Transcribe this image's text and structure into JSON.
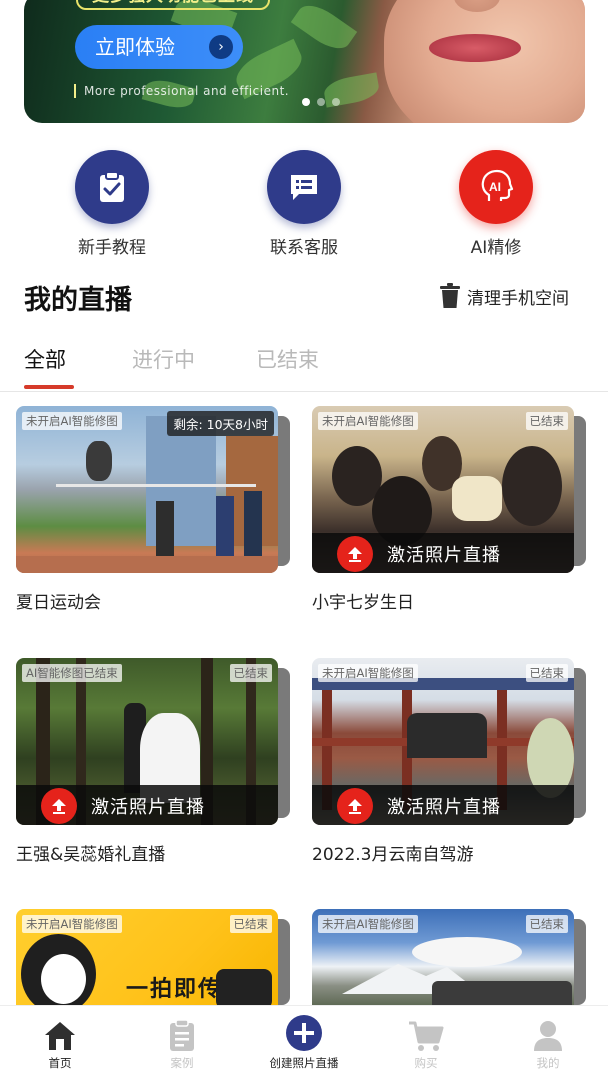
{
  "banner": {
    "headline": "更多强大功能已上线",
    "cta_label": "立即体验",
    "subtitle": "More professional and efficient.",
    "carousel_pages": 3,
    "carousel_active": 1
  },
  "quick_actions": [
    {
      "label": "新手教程",
      "icon": "clipboard-check-icon",
      "color": "#2f3b8a"
    },
    {
      "label": "联系客服",
      "icon": "message-icon",
      "color": "#2f3b8a"
    },
    {
      "label": "AI精修",
      "icon": "ai-head-icon",
      "color": "#e5231b"
    }
  ],
  "section": {
    "title": "我的直播",
    "cleanup_label": "清理手机空间"
  },
  "tabs": [
    {
      "label": "全部",
      "active": true
    },
    {
      "label": "进行中",
      "active": false
    },
    {
      "label": "已结束",
      "active": false
    }
  ],
  "cards": [
    {
      "title": "夏日运动会",
      "ai_tag": "未开启AI智能修图",
      "remaining": "剩余: 10天8小时",
      "status": "",
      "activate": ""
    },
    {
      "title": "小宇七岁生日",
      "ai_tag": "未开启AI智能修图",
      "remaining": "",
      "status": "已结束",
      "activate": "激活照片直播"
    },
    {
      "title": "王强&吴蕊婚礼直播",
      "ai_tag": "AI智能修图已结束",
      "remaining": "",
      "status": "已结束",
      "activate": "激活照片直播"
    },
    {
      "title": "2022.3月云南自驾游",
      "ai_tag": "未开启AI智能修图",
      "remaining": "",
      "status": "已结束",
      "activate": "激活照片直播"
    },
    {
      "title": "",
      "ai_tag": "未开启AI智能修图",
      "remaining": "",
      "status": "已结束",
      "activate": "",
      "photo_text": "一拍即传"
    },
    {
      "title": "",
      "ai_tag": "未开启AI智能修图",
      "remaining": "",
      "status": "已结束",
      "activate": ""
    }
  ],
  "bottom_nav": [
    {
      "label": "首页",
      "icon": "home-icon",
      "active": true
    },
    {
      "label": "案例",
      "icon": "document-icon",
      "active": false
    },
    {
      "label": "创建照片直播",
      "icon": "plus-circle-icon",
      "active": true
    },
    {
      "label": "购买",
      "icon": "cart-icon",
      "active": false
    },
    {
      "label": "我的",
      "icon": "user-icon",
      "active": false
    }
  ],
  "colors": {
    "navy": "#2f3b8a",
    "red": "#e5231b",
    "tab_underline": "#d63a2a",
    "cta_blue": "#2a7ff5"
  }
}
